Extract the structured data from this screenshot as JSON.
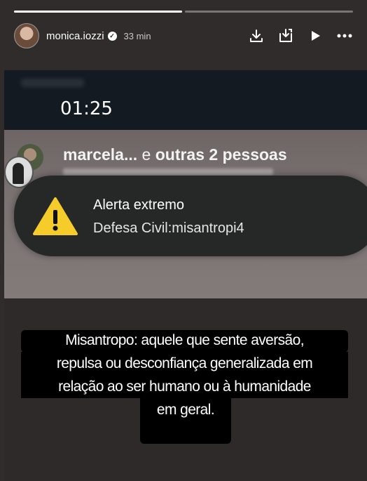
{
  "story": {
    "progress": [
      1.0,
      0.0
    ],
    "username": "monica.iozzi",
    "time_ago": "33 min"
  },
  "header_icons": [
    "download-icon",
    "save-to-device-icon",
    "play-icon",
    "more-icon"
  ],
  "screenshot": {
    "clock": "01:25",
    "notification": {
      "name": "marcela...",
      "rest": "e ",
      "others": "outras 2 pessoas"
    },
    "alert": {
      "title": "Alerta extremo",
      "subtitle": "Defesa Civil:misantropi4"
    }
  },
  "caption": [
    "Misantropo: aquele que sente aversão,",
    "repulsa ou desconfiança generalizada em",
    "relação ao ser humano ou à humanidade",
    "em geral."
  ],
  "colors": {
    "background": "#2f2c2b",
    "alert_bg": "#262727",
    "warning_yellow": "#f5cc2a"
  }
}
